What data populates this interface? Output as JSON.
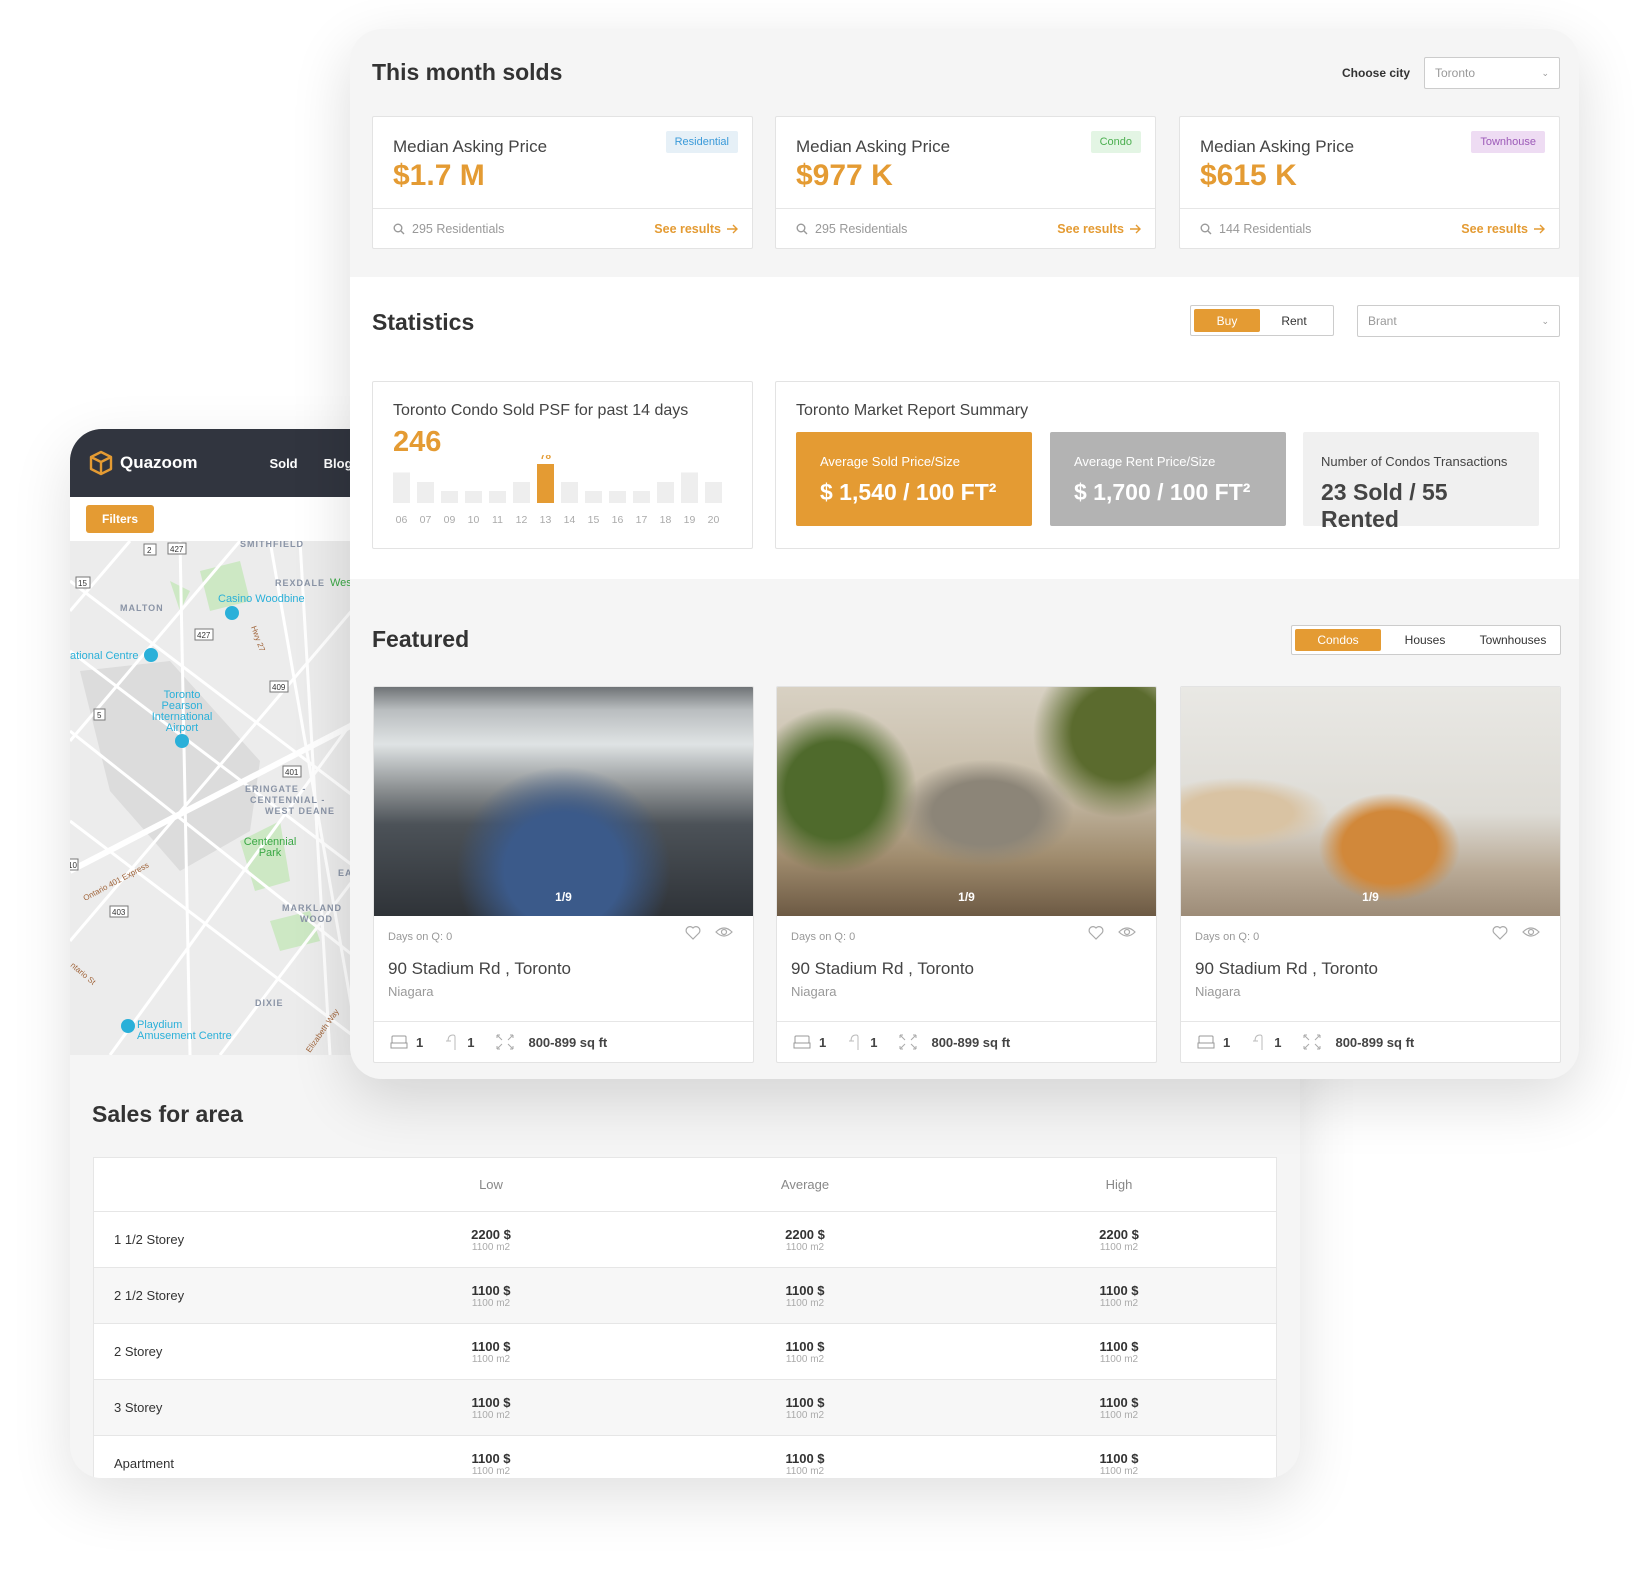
{
  "brand": {
    "name": "Quazoom",
    "accent": "#e49b33",
    "dark": "#31353f"
  },
  "back_nav": {
    "items": [
      "Sold",
      "Blog"
    ],
    "filters_label": "Filters"
  },
  "map": {
    "labels": [
      "SMITHFIELD",
      "REXDALE",
      "West",
      "Casino Woodbine",
      "MALTON",
      "Hwy 27",
      "ational Centre",
      "Toronto",
      "Pearson",
      "International",
      "Airport",
      "ERINGATE -",
      "CENTENNIAL -",
      "WEST DEANE",
      "Centennial",
      "Park",
      "Ontario 401 Express",
      "MARKLAND",
      "WOOD",
      "EATO",
      "DIXIE",
      "Playdium",
      "Amusement Centre",
      "ntario St",
      "Elizabeth Way"
    ],
    "shields": [
      "2",
      "427",
      "15",
      "427",
      "409",
      "5",
      "401",
      "403",
      "10"
    ]
  },
  "sales": {
    "title": "Sales for area",
    "columns": [
      "",
      "Low",
      "Average",
      "High"
    ],
    "rows": [
      {
        "type": "1 1/2 Storey",
        "low": "2200 $",
        "low_area": "1100 m2",
        "avg": "2200 $",
        "avg_area": "1100 m2",
        "high": "2200 $",
        "high_area": "1100 m2"
      },
      {
        "type": "2 1/2 Storey",
        "low": "1100 $",
        "low_area": "1100 m2",
        "avg": "1100 $",
        "avg_area": "1100 m2",
        "high": "1100 $",
        "high_area": "1100 m2"
      },
      {
        "type": "2 Storey",
        "low": "1100 $",
        "low_area": "1100 m2",
        "avg": "1100 $",
        "avg_area": "1100 m2",
        "high": "1100 $",
        "high_area": "1100 m2"
      },
      {
        "type": "3 Storey",
        "low": "1100 $",
        "low_area": "1100 m2",
        "avg": "1100 $",
        "avg_area": "1100 m2",
        "high": "1100 $",
        "high_area": "1100 m2"
      },
      {
        "type": "Apartment",
        "low": "1100 $",
        "low_area": "1100 m2",
        "avg": "1100 $",
        "avg_area": "1100 m2",
        "high": "1100 $",
        "high_area": "1100 m2"
      }
    ]
  },
  "solds": {
    "title": "This month solds",
    "city_label": "Choose city",
    "city_value": "Toronto",
    "cards": [
      {
        "label": "Median Asking Price",
        "value": "$1.7 M",
        "tag": "Residential",
        "tag_color": "#3a9ad9",
        "tag_bg": "#e6f0f7",
        "count": "295 Residentials",
        "link": "See results"
      },
      {
        "label": "Median Asking Price",
        "value": "$977 K",
        "tag": "Condo",
        "tag_color": "#4caf50",
        "tag_bg": "#e3f5e4",
        "count": "295 Residentials",
        "link": "See results"
      },
      {
        "label": "Median Asking Price",
        "value": "$615 K",
        "tag": "Townhouse",
        "tag_color": "#9c5ab8",
        "tag_bg": "#eedcf3",
        "count": "144 Residentials",
        "link": "See results"
      }
    ]
  },
  "statistics": {
    "title": "Statistics",
    "toggle": [
      "Buy",
      "Rent"
    ],
    "active": "Buy",
    "region_value": "Brant",
    "psf": {
      "title": "Toronto Condo Sold PSF for past 14 days",
      "value": "246"
    },
    "market": {
      "title": "Toronto Market Report Summary",
      "boxes": [
        {
          "label": "Average Sold Price/Size",
          "value": "$ 1,540 / 100 FT²"
        },
        {
          "label": "Average Rent Price/Size",
          "value": "$ 1,700 / 100 FT²"
        },
        {
          "label": "Number of Condos Transactions",
          "value": "23 Sold / 55 Rented"
        }
      ]
    }
  },
  "chart_data": {
    "type": "bar",
    "categories": [
      "06",
      "07",
      "09",
      "10",
      "11",
      "12",
      "13",
      "14",
      "15",
      "16",
      "17",
      "18",
      "19",
      "20"
    ],
    "values": [
      61,
      42,
      24,
      24,
      24,
      42,
      78,
      42,
      24,
      24,
      24,
      42,
      61,
      42
    ],
    "highlight": "13",
    "highlight_label": "78",
    "grid": false,
    "title": "",
    "xlabel": "",
    "ylabel": ""
  },
  "featured": {
    "title": "Featured",
    "tabs": [
      "Condos",
      "Houses",
      "Townhouses"
    ],
    "active": "Condos",
    "items": [
      {
        "photo_count": "1/9",
        "days": "Days on Q: 0",
        "address": "90 Stadium Rd , Toronto",
        "region": "Niagara",
        "beds": "1",
        "baths": "1",
        "size": "800-899 sq ft"
      },
      {
        "photo_count": "1/9",
        "days": "Days on Q: 0",
        "address": "90 Stadium Rd , Toronto",
        "region": "Niagara",
        "beds": "1",
        "baths": "1",
        "size": "800-899 sq ft"
      },
      {
        "photo_count": "1/9",
        "days": "Days on Q: 0",
        "address": "90 Stadium Rd , Toronto",
        "region": "Niagara",
        "beds": "1",
        "baths": "1",
        "size": "800-899 sq ft"
      }
    ]
  }
}
